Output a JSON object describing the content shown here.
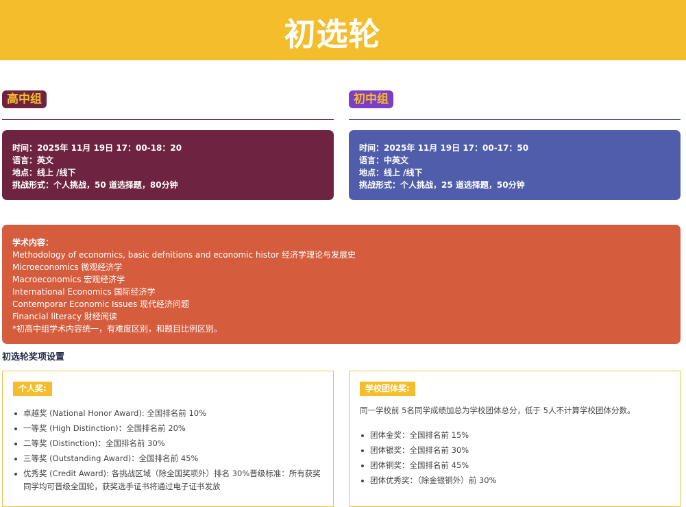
{
  "banner": {
    "title": "初选轮"
  },
  "groups": {
    "high": {
      "tag": "高中组",
      "lines": [
        "时间：2025年 11月 19日 17：00-18：20",
        "语言：英文",
        "地点：线上 /线下",
        "挑战形式：个人挑战，50 道选择题，80分钟"
      ]
    },
    "junior": {
      "tag": "初中组",
      "lines": [
        "时间：2025年 11月 19日 17：00-17：50",
        "语言：中英文",
        "地点：线上 /线下",
        "挑战形式：个人挑战，25 道选择题，50分钟"
      ]
    }
  },
  "academic": {
    "heading": "学术内容：",
    "lines": [
      "Methodology of economics, basic defnitions and economic histor 经济学理论与发展史",
      "Microeconomics 微观经济学",
      "Macroeconomics 宏观经济学",
      "International Economics 国际经济学",
      "Contemporar Economic Issues 现代经济问题",
      "Financial literacy 财经阅读",
      "*初高中组学术内容统一，有难度区别，和题目比例区别。"
    ]
  },
  "awards": {
    "title": "初选轮奖项设置",
    "individual": {
      "label": "个人奖:",
      "items": [
        "卓越奖 (National Honor Award): 全国排名前 10%",
        "一等奖 (High Distinction)：全国排名前 20%",
        "二等奖 (Distinction)：全国排名前 30%",
        "三等奖 (Outstanding Award)：全国排名前 45%",
        "优秀奖 (Credit Award): 各挑战区域（除全国奖项外）排名 30%晋级标准：所有获奖同学均可晋级全国轮，获奖选手证书将通过电子证书发放"
      ]
    },
    "team": {
      "label": "学校团体奖:",
      "intro": "同一学校前 5名同学成绩加总为学校团体总分，低于 5人不计算学校团体分数。",
      "items": [
        "团体金奖：全国排名前 15%",
        "团体银奖：全国排名前 30%",
        "团体铜奖：全国排名前 45%",
        "团体优秀奖：（除金银铜外）前 30%"
      ]
    }
  }
}
